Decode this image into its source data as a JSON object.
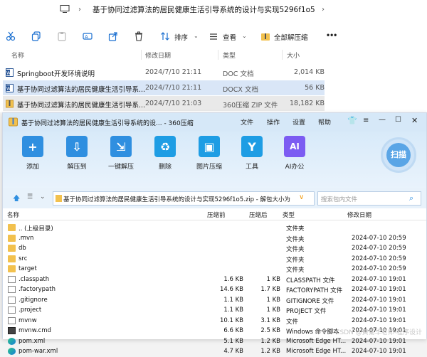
{
  "explorer": {
    "breadcrumb": "基于协同过滤算法的居民健康生活引导系统的设计与实现5296f1o5",
    "toolbar": {
      "sort_label": "排序",
      "view_label": "查看",
      "extract_label": "全部解压缩",
      "more_label": "•••"
    },
    "columns": [
      "名称",
      "修改日期",
      "类型",
      "大小"
    ],
    "files": [
      {
        "name": "Springboot开发环境说明",
        "date": "2024/7/10 21:11",
        "type": "DOC 文档",
        "size": "2,014 KB",
        "icon": "word-doc-icon"
      },
      {
        "name": "基于协同过滤算法的居民健康生活引导系...",
        "date": "2024/7/10 21:11",
        "type": "DOCX 文档",
        "size": "56 KB",
        "icon": "word-docx-icon"
      },
      {
        "name": "基于协同过滤算法的居民健康生活引导系...",
        "date": "2024/7/10 21:03",
        "type": "360压缩 ZIP 文件",
        "size": "18,182 KB",
        "icon": "zip-archive-icon"
      }
    ]
  },
  "zip360": {
    "title": "基于协同过滤算法的居民健康生活引导系统的设... - 360压缩",
    "menu": [
      "文件",
      "操作",
      "设置",
      "帮助"
    ],
    "tools": [
      {
        "label": "添加",
        "icon": "add-icon",
        "color": "#2f8fe0",
        "glyph": "+"
      },
      {
        "label": "解压到",
        "icon": "extract-to-icon",
        "color": "#2f8fe0",
        "glyph": "⇩"
      },
      {
        "label": "一键解压",
        "icon": "one-click-extract-icon",
        "color": "#2f8fe0",
        "glyph": "⇲"
      },
      {
        "label": "删除",
        "icon": "delete-recycle-icon",
        "color": "#1e9de4",
        "glyph": "♻"
      },
      {
        "label": "图片压缩",
        "icon": "image-compress-icon",
        "color": "#1e9de4",
        "glyph": "▣"
      },
      {
        "label": "工具",
        "icon": "tools-icon",
        "color": "#1e9de4",
        "glyph": "Y"
      },
      {
        "label": "AI办公",
        "icon": "ai-office-icon",
        "color": "#7c5cf2",
        "glyph": "AI"
      }
    ],
    "scan_label": "扫描",
    "path": "基于协同过滤算法的居民健康生活引导系统的设计与实现5296f1o5.zip - 解包大小为",
    "search_placeholder": "搜索包内文件",
    "columns": [
      "名称",
      "压缩前",
      "压缩后",
      "类型",
      "修改日期"
    ],
    "rows": [
      {
        "name": ".. (上级目录)",
        "before": "",
        "after": "",
        "type": "文件夹",
        "date": "",
        "icon": "folder-icon"
      },
      {
        "name": ".mvn",
        "before": "",
        "after": "",
        "type": "文件夹",
        "date": "2024-07-10 20:59",
        "icon": "folder-icon"
      },
      {
        "name": "db",
        "before": "",
        "after": "",
        "type": "文件夹",
        "date": "2024-07-10 20:59",
        "icon": "folder-icon"
      },
      {
        "name": "src",
        "before": "",
        "after": "",
        "type": "文件夹",
        "date": "2024-07-10 20:59",
        "icon": "folder-icon"
      },
      {
        "name": "target",
        "before": "",
        "after": "",
        "type": "文件夹",
        "date": "2024-07-10 20:59",
        "icon": "folder-icon"
      },
      {
        "name": ".classpath",
        "before": "1.6 KB",
        "after": "1 KB",
        "type": "CLASSPATH 文件",
        "date": "2024-07-10 19:01",
        "icon": "file-icon"
      },
      {
        "name": ".factorypath",
        "before": "14.6 KB",
        "after": "1.7 KB",
        "type": "FACTORYPATH 文件",
        "date": "2024-07-10 19:01",
        "icon": "file-icon"
      },
      {
        "name": ".gitignore",
        "before": "1.1 KB",
        "after": "1 KB",
        "type": "GITIGNORE 文件",
        "date": "2024-07-10 19:01",
        "icon": "file-icon"
      },
      {
        "name": ".project",
        "before": "1.1 KB",
        "after": "1 KB",
        "type": "PROJECT 文件",
        "date": "2024-07-10 19:01",
        "icon": "file-icon"
      },
      {
        "name": "mvnw",
        "before": "10.1 KB",
        "after": "3.1 KB",
        "type": "文件",
        "date": "2024-07-10 19:01",
        "icon": "file-icon"
      },
      {
        "name": "mvnw.cmd",
        "before": "6.6 KB",
        "after": "2.5 KB",
        "type": "Windows 命令脚本",
        "date": "2024-07-10 19:01",
        "icon": "cmd-script-icon"
      },
      {
        "name": "pom.xml",
        "before": "5.1 KB",
        "after": "1.2 KB",
        "type": "Microsoft Edge HT...",
        "date": "2024-07-10 19:01",
        "icon": "edge-icon"
      },
      {
        "name": "pom-war.xml",
        "before": "4.7 KB",
        "after": "1.2 KB",
        "type": "Microsoft Edge HT...",
        "date": "2024-07-10 19:01",
        "icon": "edge-icon"
      }
    ],
    "watermark": "CSDN @黄菊华老师-程序设计"
  }
}
